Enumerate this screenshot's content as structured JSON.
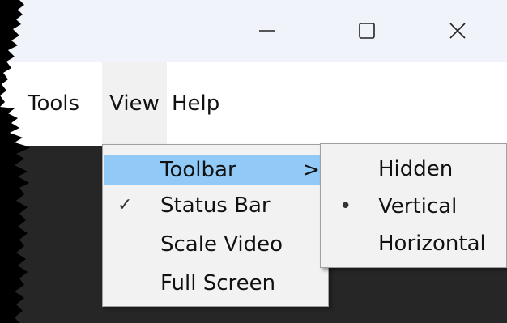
{
  "window_controls": {
    "minimize_icon": "minimize-icon",
    "maximize_icon": "maximize-icon",
    "close_icon": "close-icon"
  },
  "menubar": {
    "items": [
      {
        "label": "Tools"
      },
      {
        "label": "View",
        "open": true
      },
      {
        "label": "Help"
      }
    ]
  },
  "view_menu": {
    "items": [
      {
        "label": "Toolbar",
        "highlighted": true,
        "has_submenu": true,
        "submenu_arrow": ">"
      },
      {
        "label": "Status Bar",
        "checked": true,
        "check_mark": "✓"
      },
      {
        "label": "Scale Video"
      },
      {
        "label": "Full Screen"
      }
    ]
  },
  "toolbar_submenu": {
    "items": [
      {
        "label": "Hidden"
      },
      {
        "label": "Vertical",
        "selected": true,
        "radio_mark": "•"
      },
      {
        "label": "Horizontal"
      }
    ]
  },
  "colors": {
    "titlebar": "#f0f3f9",
    "menubar": "#ffffff",
    "content": "#262626",
    "menu_background": "#f2f2f2",
    "menu_highlight": "#91c9f7"
  }
}
